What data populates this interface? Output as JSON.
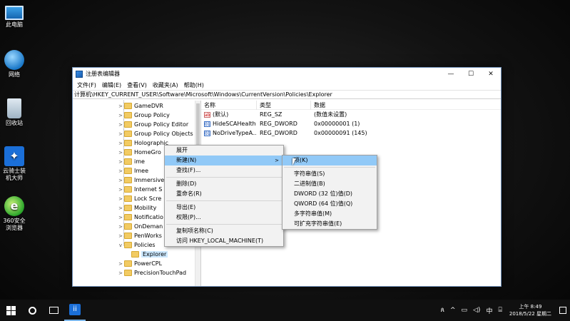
{
  "desktop": {
    "icons": [
      {
        "label": "此电脑",
        "icon": "computer-icon"
      },
      {
        "label": "网络",
        "icon": "network-icon"
      },
      {
        "label": "回收站",
        "icon": "recycle-bin-icon"
      },
      {
        "label": "云骑士装机大师",
        "icon": "yunqishi-icon"
      },
      {
        "label": "360安全浏览器",
        "icon": "browser-360-icon"
      }
    ]
  },
  "window": {
    "title": "注册表编辑器",
    "controls": {
      "minimize": "—",
      "maximize": "☐",
      "close": "✕"
    },
    "menu": [
      "文件(F)",
      "编辑(E)",
      "查看(V)",
      "收藏夹(A)",
      "帮助(H)"
    ],
    "address": "计算机\\HKEY_CURRENT_USER\\Software\\Microsoft\\Windows\\CurrentVersion\\Policies\\Explorer",
    "tree": [
      {
        "label": "GameDVR",
        "expander": ">"
      },
      {
        "label": "Group Policy",
        "expander": ">"
      },
      {
        "label": "Group Policy Editor",
        "expander": ">"
      },
      {
        "label": "Group Policy Objects",
        "expander": ">"
      },
      {
        "label": "Holographic",
        "expander": ">"
      },
      {
        "label": "HomeGro",
        "expander": ">"
      },
      {
        "label": "ime",
        "expander": ">"
      },
      {
        "label": "Imee",
        "expander": ">"
      },
      {
        "label": "Immersive",
        "expander": ">"
      },
      {
        "label": "Internet S",
        "expander": ">"
      },
      {
        "label": "Lock Scre",
        "expander": ">"
      },
      {
        "label": "Mobility",
        "expander": ">"
      },
      {
        "label": "Notificatio",
        "expander": ">"
      },
      {
        "label": "OnDeman",
        "expander": ">"
      },
      {
        "label": "PenWorks",
        "expander": ">"
      },
      {
        "label": "Policies",
        "expander": "v"
      },
      {
        "label": "Explorer",
        "expander": ""
      },
      {
        "label": "PowerCPL",
        "expander": ">"
      },
      {
        "label": "PrecisionTouchPad",
        "expander": ">"
      }
    ],
    "columns": [
      "名称",
      "类型",
      "数据"
    ],
    "values": [
      {
        "name": "(默认)",
        "type": "REG_SZ",
        "data": "(数值未设置)",
        "icon": "ab"
      },
      {
        "name": "HideSCAHealth",
        "type": "REG_DWORD",
        "data": "0x00000001 (1)",
        "icon": "01"
      },
      {
        "name": "NoDriveTypeA...",
        "type": "REG_DWORD",
        "data": "0x00000091 (145)",
        "icon": "01"
      }
    ]
  },
  "context_menu": {
    "items": [
      "展开",
      "新建(N)",
      "查找(F)...",
      "删除(D)",
      "重命名(R)",
      "导出(E)",
      "权限(P)...",
      "复制项名称(C)",
      "访问 HKEY_LOCAL_MACHINE(T)"
    ],
    "arrow": ">"
  },
  "submenu": {
    "items": [
      "项(K)",
      "字符串值(S)",
      "二进制值(B)",
      "DWORD (32 位)值(D)",
      "QWORD (64 位)值(Q)",
      "多字符串值(M)",
      "可扩充字符串值(E)"
    ]
  },
  "taskbar": {
    "pinned_label": "ii",
    "tray": {
      "people": "ጰ",
      "chevron": "^",
      "network": "▭",
      "volume": "◁)",
      "ime": "中",
      "input": "⌸"
    },
    "clock": {
      "time": "上午 8:49",
      "date": "2018/5/22 星期二"
    }
  }
}
